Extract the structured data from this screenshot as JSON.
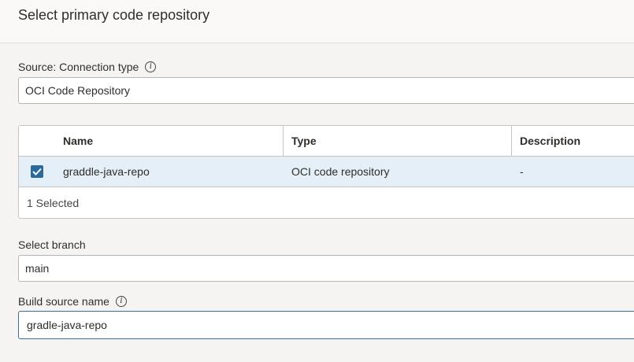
{
  "header": {
    "title": "Select primary code repository"
  },
  "source": {
    "label": "Source: Connection type",
    "value": "OCI Code Repository"
  },
  "table": {
    "columns": [
      "Name",
      "Type",
      "Description"
    ],
    "rows": [
      {
        "selected": true,
        "name": "graddle-java-repo",
        "type": "OCI code repository",
        "description": "-"
      }
    ],
    "footer": "1 Selected"
  },
  "branch": {
    "label": "Select branch",
    "value": "main"
  },
  "build_source": {
    "label": "Build source name",
    "value": "gradle-java-repo"
  },
  "colors": {
    "selected_row": "#e4eff7",
    "checkbox": "#2c6a9b",
    "focus_border": "#3a6f95"
  }
}
